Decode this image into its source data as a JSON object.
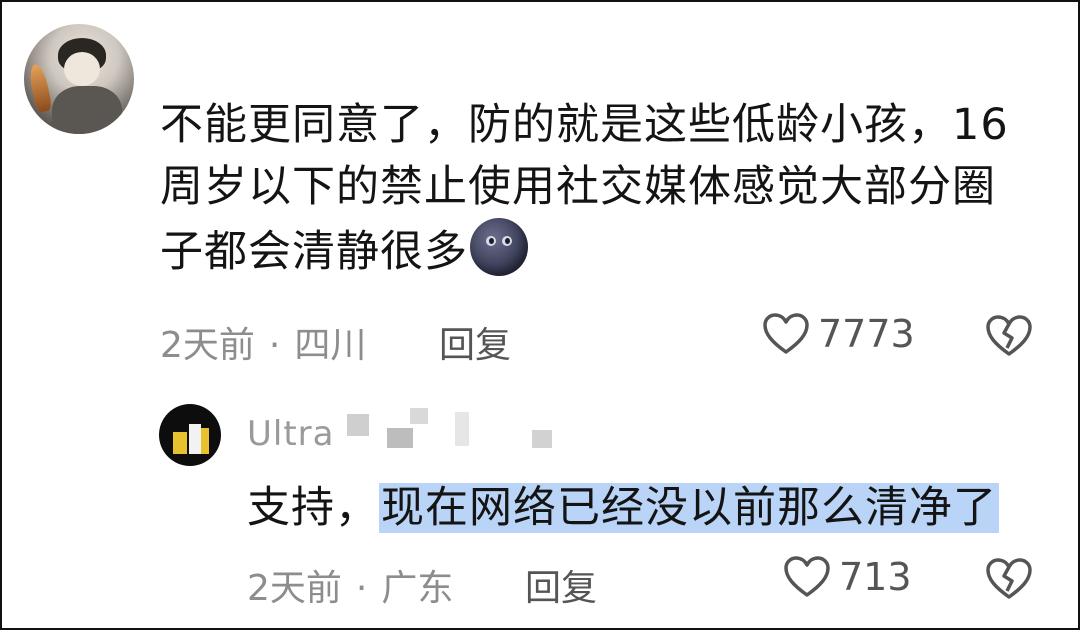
{
  "comment": {
    "text": "不能更同意了，防的就是这些低龄小孩，16周岁以下的禁止使用社交媒体感觉大部分圈子都会清静很多",
    "time": "2天前",
    "location": "四川",
    "reply_label": "回复",
    "likes": "7773"
  },
  "reply": {
    "username_visible": "Ultra",
    "text_before": "支持，",
    "text_highlighted": "现在网络已经没以前那么清净了",
    "time": "2天前",
    "location": "广东",
    "reply_label": "回复",
    "likes": "713"
  },
  "separator": "·",
  "icons": {
    "heart": "heart-outline-icon",
    "broken_heart": "broken-heart-icon",
    "emoji": "new-moon-face-emoji"
  },
  "colors": {
    "text": "#141414",
    "meta": "#8d8d8d",
    "highlight": "#b9d4f6"
  }
}
